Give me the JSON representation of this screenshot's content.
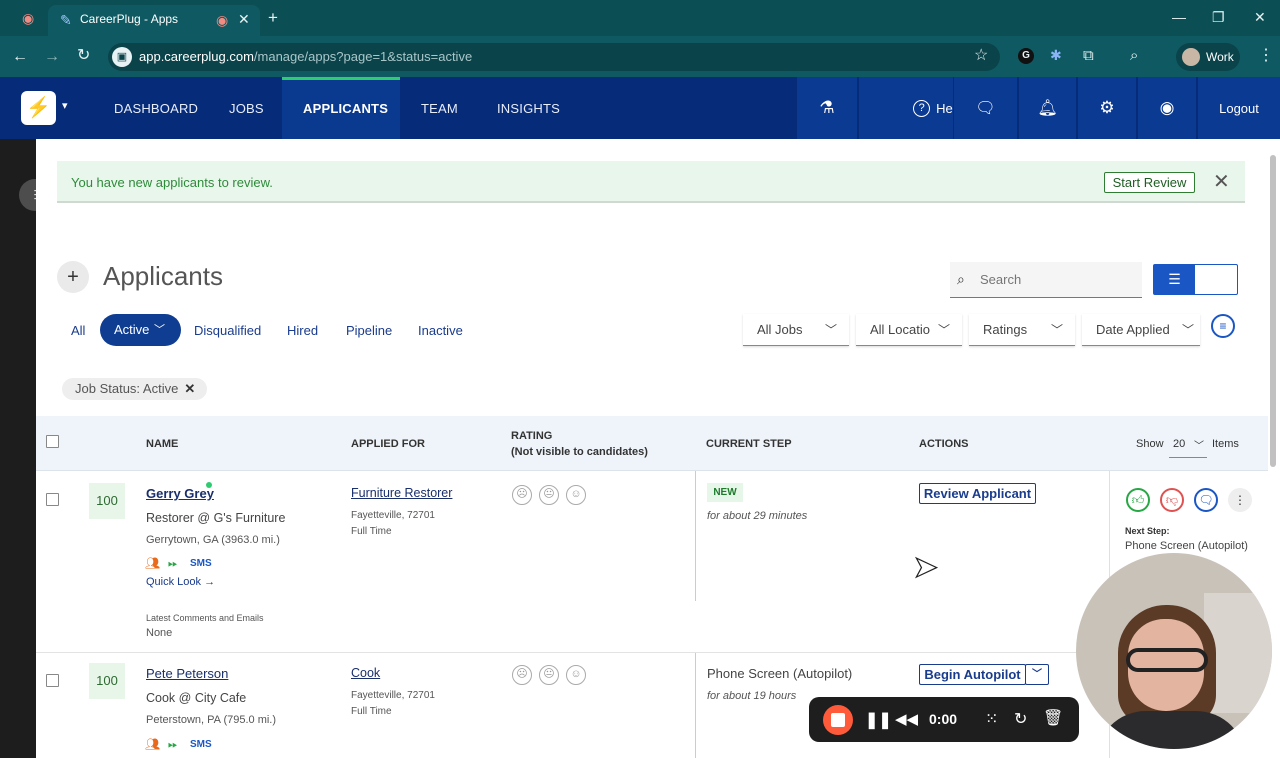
{
  "browser": {
    "tab_title": "CareerPlug - Apps",
    "url_host": "app.careerplug.com",
    "url_path": "/manage/apps?page=1&status=active",
    "profile_label": "Work"
  },
  "nav": {
    "items": [
      "DASHBOARD",
      "JOBS",
      "APPLICANTS",
      "TEAM",
      "INSIGHTS"
    ],
    "active": "APPLICANTS",
    "help_label": "Help",
    "logout_label": "Logout"
  },
  "banner": {
    "message": "You have new applicants to review.",
    "start_review_label": "Start Review"
  },
  "page": {
    "title": "Applicants",
    "search_placeholder": "Search"
  },
  "status_tabs": [
    "All",
    "Active",
    "Disqualified",
    "Hired",
    "Pipeline",
    "Inactive"
  ],
  "status_active": "Active",
  "filters": {
    "jobs": "All Jobs",
    "locations": "All Locatio",
    "ratings": "Ratings",
    "date": "Date Applied"
  },
  "chip": {
    "label": "Job Status: Active"
  },
  "table": {
    "headers": {
      "name": "NAME",
      "applied_for": "APPLIED FOR",
      "rating": "RATING",
      "rating_note": "(Not visible to candidates)",
      "current_step": "CURRENT STEP",
      "actions": "ACTIONS",
      "show": "Show",
      "per_page": "20",
      "items": "Items"
    },
    "rows": [
      {
        "score": "100",
        "name": "Gerry Grey",
        "title": "Restorer @ G's Furniture",
        "location": "Gerrytown, GA (3963.0 mi.)",
        "sms": "SMS",
        "quick_look": "Quick Look →",
        "comments_label": "Latest Comments and Emails",
        "comments_value": "None",
        "job": "Furniture Restorer",
        "job_location": "Fayetteville, 72701",
        "job_type": "Full Time",
        "step": "NEW",
        "step_time": "for about 29 minutes",
        "action": "Review Applicant",
        "next_step_label": "Next Step:",
        "next_step_value": "Phone Screen (Autopilot)"
      },
      {
        "score": "100",
        "name": "Pete Peterson",
        "title": "Cook @ City Cafe",
        "location": "Peterstown, PA (795.0 mi.)",
        "sms": "SMS",
        "job": "Cook",
        "job_location": "Fayetteville, 72701",
        "job_type": "Full Time",
        "step": "Phone Screen (Autopilot)",
        "step_time": "for about 19 hours",
        "action": "Begin Autopilot"
      }
    ]
  },
  "recorder": {
    "time": "0:00"
  },
  "colors": {
    "nav_bg": "#062b78",
    "accent_green": "#2ecc71",
    "primary_blue": "#1a56c4",
    "banner_bg": "#e9f6ec",
    "chrome_bg": "#0b4f55"
  }
}
